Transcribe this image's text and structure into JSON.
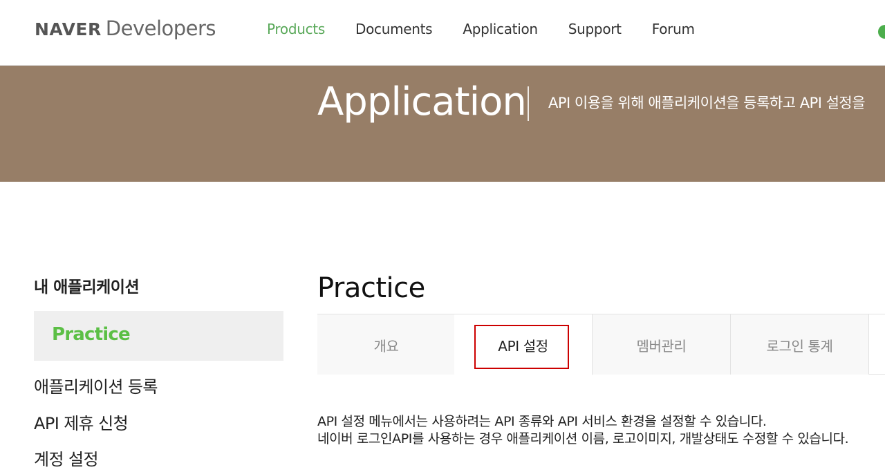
{
  "header": {
    "logo_naver": "NAVER",
    "logo_developers": "Developers",
    "nav": [
      {
        "label": "Products",
        "active": true
      },
      {
        "label": "Documents",
        "active": false
      },
      {
        "label": "Application",
        "active": false
      },
      {
        "label": "Support",
        "active": false
      },
      {
        "label": "Forum",
        "active": false
      }
    ]
  },
  "banner": {
    "title": "Application",
    "description": "API 이용을 위해 애플리케이션을 등록하고 API 설정을"
  },
  "sidebar": {
    "heading": "내 애플리케이션",
    "active_item": "Practice",
    "links": [
      "애플리케이션 등록",
      "API 제휴 신청",
      "계정 설정"
    ]
  },
  "content": {
    "title": "Practice",
    "tabs": [
      {
        "label": "개요",
        "active": false
      },
      {
        "label": "API 설정",
        "active": true
      },
      {
        "label": "멤버관리",
        "active": false
      },
      {
        "label": "로그인 통계",
        "active": false
      }
    ],
    "description_lines": [
      "API 설정 메뉴에서는 사용하려는 API 종류와 API 서비스 환경을 설정할 수 있습니다.",
      "네이버 로그인API를 사용하는 경우 애플리케이션 이름, 로고이미지, 개발상태도 수정할 수 있습니다."
    ]
  },
  "colors": {
    "accent_green": "#5aa95a",
    "banner_brown": "#977e67",
    "highlight_red": "#cc0000"
  }
}
